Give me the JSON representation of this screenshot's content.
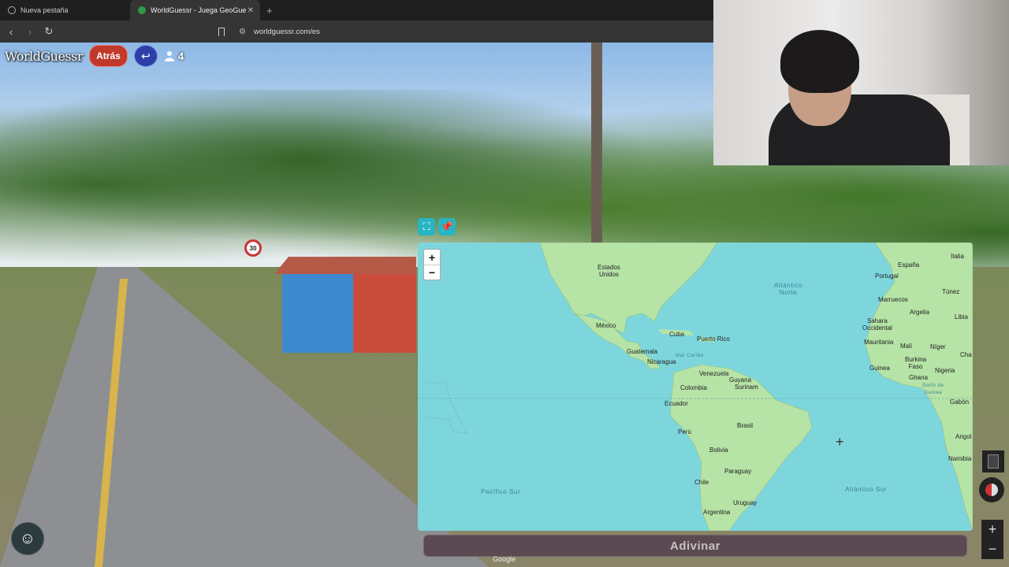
{
  "browser": {
    "tabs": [
      {
        "label": "Nueva pestaña",
        "active": false
      },
      {
        "label": "WorldGuessr - Juega GeoGue",
        "active": true
      }
    ],
    "url": "worldguessr.com/es"
  },
  "game": {
    "logo": "WorldGuessr",
    "back_label": "Atrás",
    "player_count": "4",
    "speed_sign": "30",
    "guess_label": "Adivinar",
    "map_attribution": "Google"
  },
  "map": {
    "zoom_in": "+",
    "zoom_out": "−",
    "labels": {
      "usa": "Estados\nUnidos",
      "mexico": "México",
      "cuba": "Cuba",
      "puerto_rico": "Puerto Rico",
      "guatemala": "Guatemala",
      "nicaragua": "Nicaragua",
      "mar_caribe": "Mar Caribe",
      "venezuela": "Venezuela",
      "guyana": "Guyana",
      "surinam": "Surinam",
      "colombia": "Colombia",
      "ecuador": "Ecuador",
      "peru": "Perú",
      "brasil": "Brasil",
      "bolivia": "Bolivia",
      "paraguay": "Paraguay",
      "chile": "Chile",
      "uruguay": "Uruguay",
      "argentina": "Argentina",
      "atlantico_norte": "Atlántico\nNorte",
      "atlantico_sur": "Atlántico Sur",
      "pacifico_sur": "Pacífico Sur",
      "espana": "España",
      "portugal": "Portugal",
      "italia": "Italia",
      "marruecos": "Marruecos",
      "tunez": "Túnez",
      "argelia": "Argelia",
      "libia": "Libia",
      "sahara": "Sahara\nOccidental",
      "mauritania": "Mauritania",
      "mali": "Malí",
      "niger": "Níger",
      "chad": "Cha",
      "guinea": "Guinea",
      "burkina": "Burkina\nFaso",
      "nigeria": "Nigeria",
      "ghana": "Ghana",
      "golfo": "Golfo de\nGuinea",
      "gabon": "Gabón",
      "angola": "Angol",
      "namibia": "Namibia"
    }
  },
  "colors": {
    "ocean": "#7ed6dd",
    "land": "#b6e3a6",
    "atras_button": "#c0392b",
    "back_button": "#2c3fa8",
    "map_tool": "#27b5c4",
    "guess_button": "#5b4a52"
  },
  "icons": {
    "fullscreen": "fullscreen-icon",
    "pin": "pin-icon",
    "undo": "undo-arrow-icon",
    "players": "user-icon",
    "chat": "smiley-icon"
  }
}
